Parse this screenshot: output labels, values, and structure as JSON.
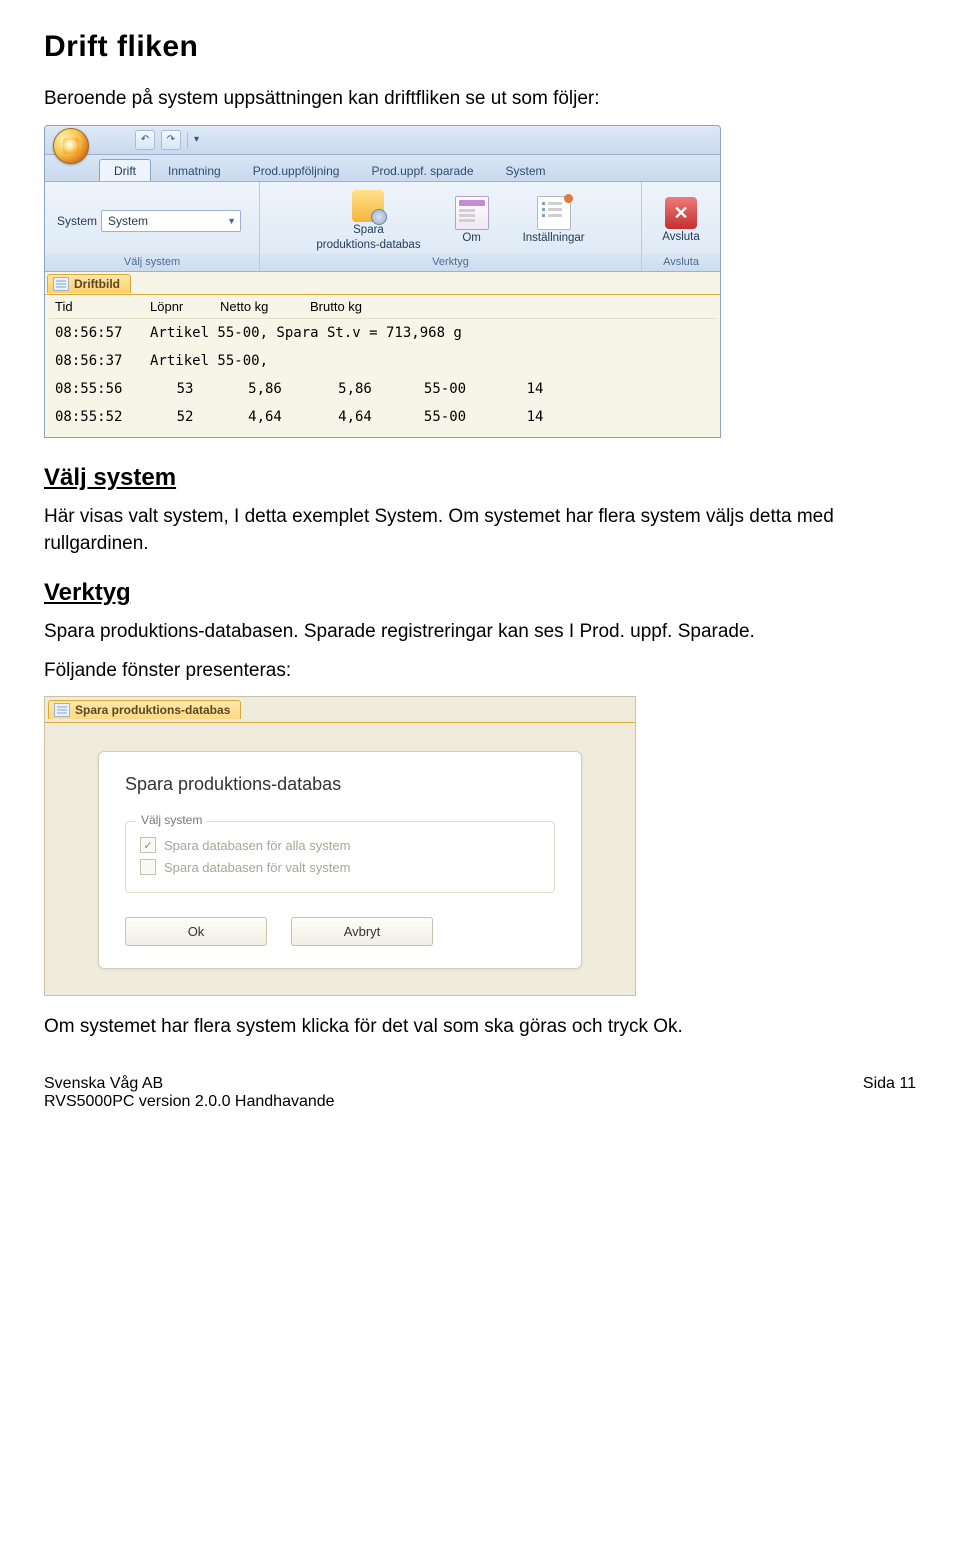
{
  "heading": "Drift fliken",
  "intro": "Beroende på system uppsättningen kan driftfliken se ut som följer:",
  "section_valj_system": {
    "title": "Välj system",
    "text": "Här visas valt system, I detta exemplet System. Om systemet har flera system väljs detta med rullgardinen."
  },
  "section_verktyg": {
    "title": "Verktyg",
    "p1": "Spara produktions-databasen. Sparade registreringar kan ses I Prod. uppf. Sparade.",
    "p2": "Följande fönster presenteras:"
  },
  "closing": "Om systemet har flera system klicka för det val som ska göras och tryck Ok.",
  "footer_left_1": "Svenska Våg AB",
  "footer_left_2": "RVS5000PC version 2.0.0 Handhavande",
  "footer_right": "Sida 11",
  "ribbon": {
    "tabs": [
      "Drift",
      "Inmatning",
      "Prod.uppföljning",
      "Prod.uppf. sparade",
      "System"
    ],
    "active_tab_index": 0,
    "group_valj": {
      "label": "Välj system",
      "combo_label": "System",
      "combo_value": "System"
    },
    "group_verktyg": {
      "label": "Verktyg",
      "btn_spara_l1": "Spara",
      "btn_spara_l2": "produktions-databas",
      "btn_om": "Om",
      "btn_inst": "Inställningar"
    },
    "group_avsluta": {
      "label": "Avsluta",
      "btn": "Avsluta"
    },
    "doc_tab": "Driftbild",
    "grid_headers": [
      "Tid",
      "Löpnr",
      "Netto kg",
      "Brutto kg"
    ],
    "grid_rows": [
      {
        "tid": "08:56:57",
        "rest": "Artikel 55-00, Spara St.v = 713,968 g"
      },
      {
        "tid": "08:56:37",
        "rest": "Artikel 55-00,"
      },
      {
        "tid": "08:55:56",
        "lop": "53",
        "net": "5,86",
        "bru": "5,86",
        "art": "55-00",
        "qty": "14"
      },
      {
        "tid": "08:55:52",
        "lop": "52",
        "net": "4,64",
        "bru": "4,64",
        "art": "55-00",
        "qty": "14"
      }
    ]
  },
  "dialog": {
    "tab": "Spara produktions-databas",
    "title": "Spara produktions-databas",
    "fieldset_legend": "Välj system",
    "chk1_label": "Spara databasen för alla system",
    "chk1_checked": true,
    "chk2_label": "Spara databasen för valt system",
    "chk2_checked": false,
    "btn_ok": "Ok",
    "btn_cancel": "Avbryt"
  }
}
